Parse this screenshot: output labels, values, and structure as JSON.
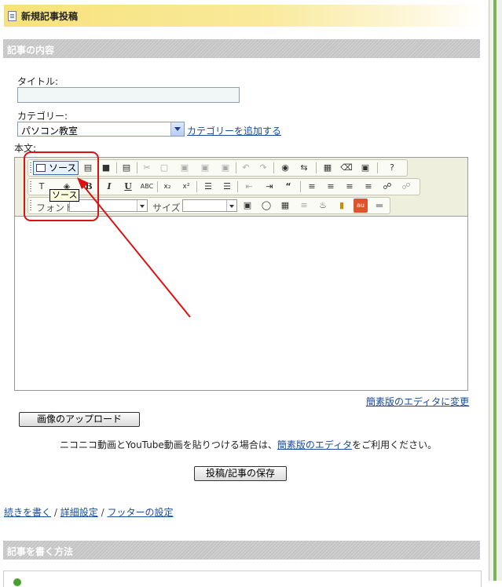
{
  "header": {
    "title": "新規記事投稿"
  },
  "section1": {
    "title": "記事の内容"
  },
  "form": {
    "title_label": "タイトル:",
    "title_value": "",
    "category_label": "カテゴリー:",
    "category_value": "パソコン教室",
    "add_category_link": "カテゴリーを追加する",
    "body_label": "本文:"
  },
  "editor": {
    "source_button": "ソース",
    "tooltip": "ソース",
    "bold": "B",
    "italic": "I",
    "underline": "U",
    "font_label": "フォント",
    "size_label": "サイズ",
    "simple_editor_link": "簡素版のエディタに変更"
  },
  "upload_button": "画像のアップロード",
  "note": {
    "prefix": "ニコニコ動画とYouTube動画を貼りつける場合は、",
    "link": "簡素版のエディタ",
    "suffix": "をご利用ください。"
  },
  "save_button": "投稿/記事の保存",
  "links": {
    "continue": "続きを書く",
    "sep1": "/",
    "details": "詳細設定",
    "sep2": "/",
    "footer": "フッターの設定"
  },
  "section2": {
    "title": "記事を書く方法"
  },
  "colors": {
    "annotation": "#dd1111",
    "header_gradient": "#f7e27a",
    "section_bar": "#c4c4c4",
    "link": "#1a4c9a"
  }
}
